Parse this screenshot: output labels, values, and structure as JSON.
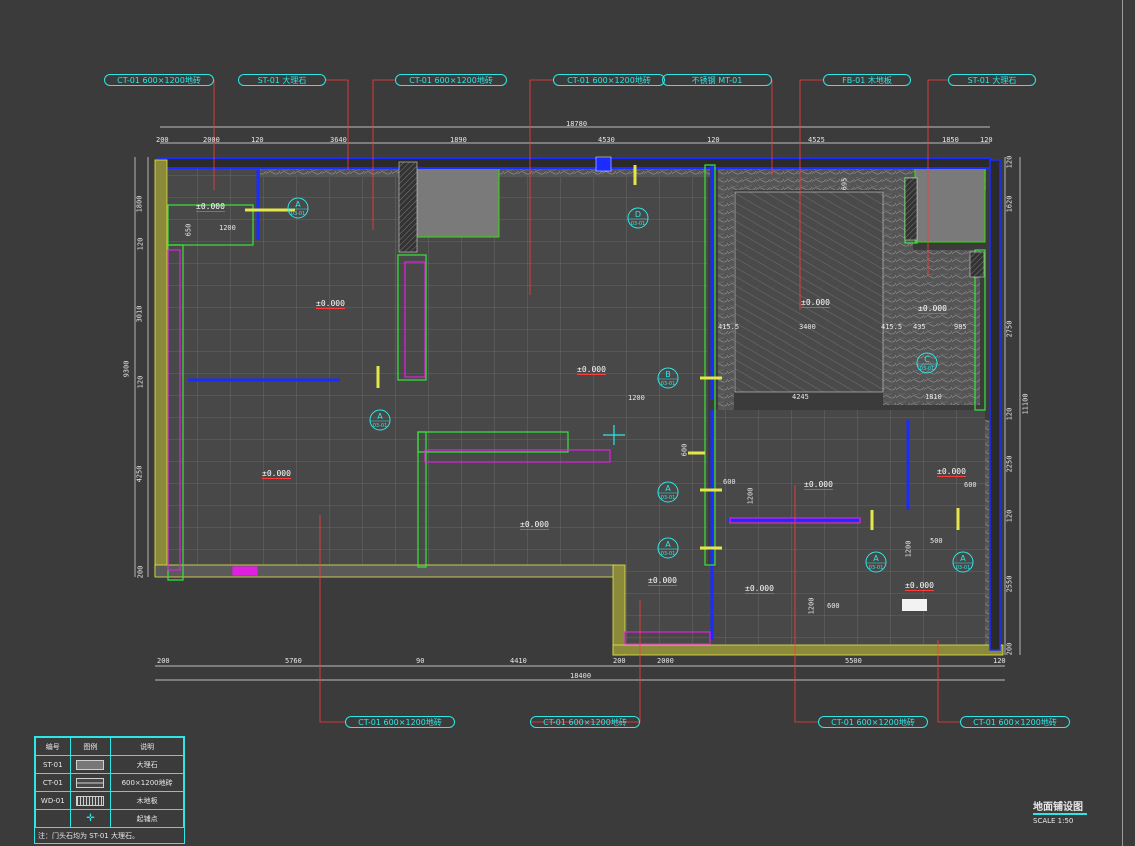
{
  "labels_top": [
    {
      "id": "l1",
      "text": "CT-01  600×1200地砖"
    },
    {
      "id": "l2",
      "text": "ST-01    大理石"
    },
    {
      "id": "l3",
      "text": "CT-01  600×1200地砖"
    },
    {
      "id": "l4",
      "text": "CT-01  600×1200地砖"
    },
    {
      "id": "l5",
      "text": "不锈钢  MT-01"
    },
    {
      "id": "l6",
      "text": "FB-01    木地板"
    },
    {
      "id": "l7",
      "text": "ST-01    大理石"
    }
  ],
  "labels_bottom": [
    {
      "id": "b1",
      "text": "CT-01  600×1200地砖"
    },
    {
      "id": "b2",
      "text": "CT-01  600×1200地砖"
    },
    {
      "id": "b3",
      "text": "CT-01  600×1200地砖"
    },
    {
      "id": "b4",
      "text": "CT-01  600×1200地砖"
    }
  ],
  "dims_top_total": "18780",
  "dims_top": [
    "200",
    "2000",
    "120",
    "3640",
    "1890",
    "4530",
    "120",
    "4525",
    "1850",
    "120"
  ],
  "dims_bottom_total": "18400",
  "dims_bottom": [
    "200",
    "5760",
    "90",
    "4410",
    "200",
    "2000",
    "5500",
    "120"
  ],
  "dims_left": [
    "1800",
    "120",
    "3010",
    "120",
    "4250",
    "200"
  ],
  "dims_left_total": "9300",
  "dims_right": [
    "120",
    "1620",
    "2750",
    "120",
    "2250",
    "120",
    "2550",
    "200"
  ],
  "dims_right_total": "11100",
  "inner_dims": [
    "1200",
    "650",
    "1200",
    "600",
    "600",
    "1200",
    "600",
    "1200",
    "500",
    "1200",
    "600",
    "415.5",
    "3400",
    "415.5",
    "435",
    "985",
    "1810",
    "695",
    "4245"
  ],
  "levels": [
    "±0.000",
    "±0.000",
    "±0.000",
    "±0.000",
    "±0.000",
    "±0.000",
    "±0.000",
    "±0.000",
    "±0.000",
    "±0.000",
    "±0.000",
    "±0.000"
  ],
  "section_marks": [
    "A",
    "A",
    "D",
    "B",
    "A",
    "A",
    "C",
    "A",
    "A"
  ],
  "section_sub": "03-01",
  "legend": {
    "headers": [
      "编号",
      "图例",
      "说明"
    ],
    "rows": [
      {
        "code": "ST-01",
        "desc": "大理石"
      },
      {
        "code": "CT-01",
        "desc": "600×1200地砖"
      },
      {
        "code": "WD-01",
        "desc": "木地板"
      },
      {
        "code": "",
        "desc": "起铺点"
      }
    ],
    "note": "注：门头石均为 ST-01 大理石。"
  },
  "title": "地面铺设图",
  "scale": "SCALE  1:50",
  "colors": {
    "background": "#3b3b3b",
    "cyan": "#2ee6e6",
    "red": "#ff3b3b",
    "blue": "#1a2cff",
    "yellow": "#e6e64a",
    "magenta": "#e020e0",
    "green": "#39e639",
    "wall": "#7a7a7a",
    "grid": "#8a8a8a",
    "label": "#2ee6e6"
  }
}
